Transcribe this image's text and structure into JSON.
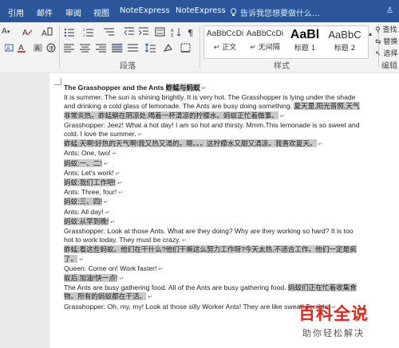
{
  "tabs": {
    "items": [
      "引用",
      "邮件",
      "审阅",
      "视图",
      "NoteExpress",
      "NoteExpress"
    ],
    "tell_me": "告诉我您想要做什么...",
    "share": "♙"
  },
  "ribbon": {
    "font_size_dec": "A",
    "paragraph_label": "段落",
    "styles_label": "样式",
    "editing_label": "编辑",
    "styles": [
      {
        "sample": "AaBbCcDi",
        "name": "↵ 正文"
      },
      {
        "sample": "AaBbCcDi",
        "name": "↵ 无间隔"
      },
      {
        "sample": "AaBl",
        "name": "标题 1"
      },
      {
        "sample": "AaBbC",
        "name": "标题 2"
      }
    ],
    "find": "查找",
    "replace": "替换",
    "select": "选择"
  },
  "document": {
    "title": "The Grasshopper and the Ants",
    "title_zh": "蚱蜢与蚂蚁",
    "lines": [
      {
        "t": "It is summer. The sun is shining brightly. It is very hot. The Grasshopper is lying under the shade and drinking a cold glass of lemonade. The Ants are busy doing something. ",
        "hl": "夏天里,阳光普照,天气非常炎热。蚱蜢躺在阴凉处,喝着一杯清凉的柠檬水。蚂蚁正忙着做事。"
      },
      {
        "t": "Grasshopper: Jeez! What a hot day! I am so hot and thirsty. Mmm.This lemonade is so sweet and cold. I love the summer.",
        "hl": ""
      },
      {
        "t": "",
        "hl": "蚱蜢:天啊!好热的天气啊!我又热又渴的。嗯。。。这柠檬水又甜又清凉。我喜欢夏天。"
      },
      {
        "t": "Ants: One, two!",
        "hl": ""
      },
      {
        "t": "",
        "hl": "蚂蚁:一、二!"
      },
      {
        "t": "Ants: Let's work!",
        "hl": ""
      },
      {
        "t": "",
        "hl": "蚂蚁:我们工作吧!"
      },
      {
        "t": "Ants: Three, four!",
        "hl": ""
      },
      {
        "t": "",
        "hl": "蚂蚁:三、四!"
      },
      {
        "t": "Ants: All day!",
        "hl": ""
      },
      {
        "t": "",
        "hl": "蚂蚁:从早到晚!"
      },
      {
        "t": "Grasshopper: Look at those Ants. What are they doing? Why are they working so hard? It is too hot to work today. They must be crazy.",
        "hl": ""
      },
      {
        "t": "",
        "hl": "蚱蜢:看这些蚂蚁。他们在干什么?他们干嘛这么努力工作呀?今天太热,不适合工作。他们一定是疯了。"
      },
      {
        "t": "Queen: Come on! Work faster!",
        "hl": ""
      },
      {
        "t": "",
        "hl": "蚁后:加油!快一点!"
      },
      {
        "t": "The Ants are busy gathering food. All of the Ants are busy gathering food. ",
        "hl": "蚂蚁们正在忙着收集食物。所有的蚂蚁都在干活。"
      },
      {
        "t": "Grasshopper: Oh, my, my! Look at those silly Worker Ants! They are like sweat! Terrible!",
        "hl": ""
      }
    ]
  },
  "watermark": {
    "big": "百科全说",
    "small": "助你轻松解决"
  }
}
